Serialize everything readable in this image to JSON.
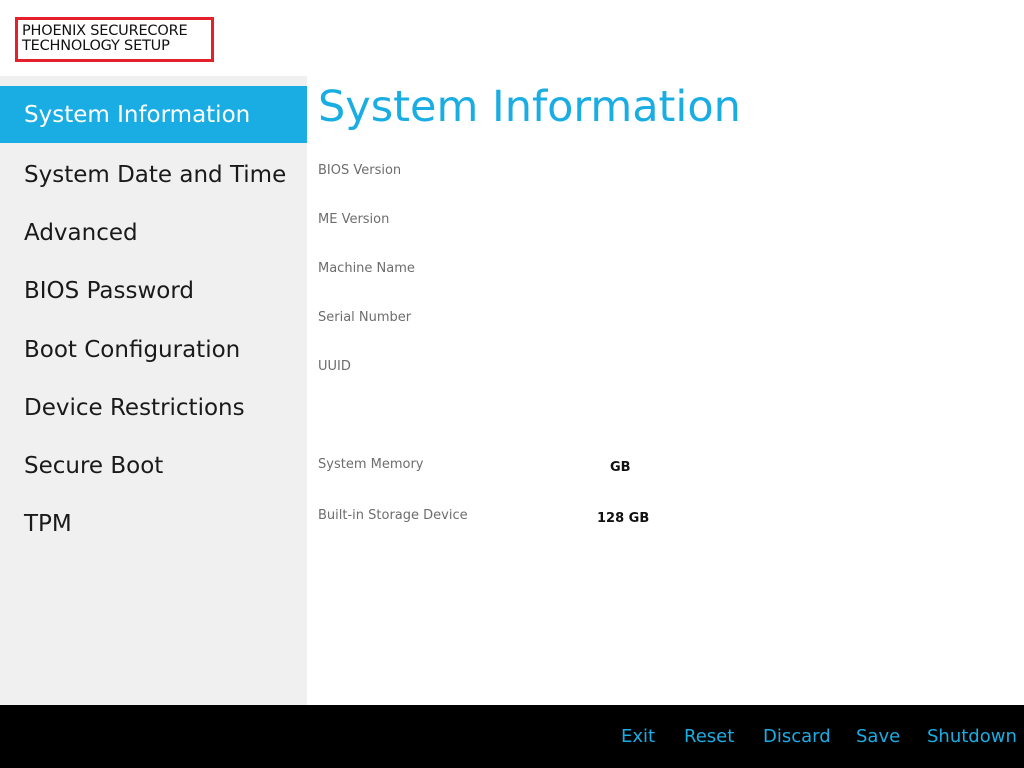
{
  "header": {
    "logo_line1": "PHOENIX SECURECORE",
    "logo_line2": "TECHNOLOGY SETUP"
  },
  "sidebar": {
    "active_index": 0,
    "items": [
      {
        "label": "System Information"
      },
      {
        "label": "System Date and Time"
      },
      {
        "label": "Advanced"
      },
      {
        "label": "BIOS Password"
      },
      {
        "label": "Boot Configuration"
      },
      {
        "label": "Device Restrictions"
      },
      {
        "label": "Secure Boot"
      },
      {
        "label": "TPM"
      }
    ]
  },
  "main": {
    "title": "System Information",
    "fields": {
      "bios_version": {
        "label": "BIOS Version",
        "value": ""
      },
      "me_version": {
        "label": "ME Version",
        "value": ""
      },
      "machine_name": {
        "label": "Machine Name",
        "value": ""
      },
      "serial_number": {
        "label": "Serial Number",
        "value": ""
      },
      "uuid": {
        "label": "UUID",
        "value": ""
      },
      "system_memory": {
        "label": "System Memory",
        "value": "GB"
      },
      "storage_device": {
        "label": "Built-in Storage Device",
        "value": "128 GB"
      }
    }
  },
  "footer": {
    "exit": "Exit",
    "reset": "Reset",
    "discard": "Discard",
    "save": "Save",
    "shutdown": "Shutdown"
  },
  "colors": {
    "accent": "#1aade3",
    "logo_border": "#e4212b",
    "sidebar_bg": "#f0f0f0",
    "footer_bg": "#000000"
  }
}
